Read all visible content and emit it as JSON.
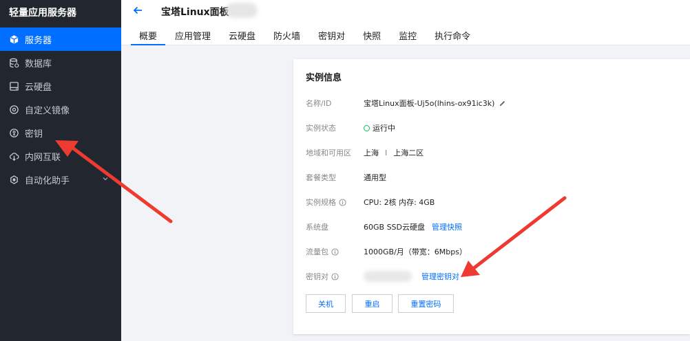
{
  "sidebar": {
    "title": "轻量应用服务器",
    "items": [
      {
        "label": "服务器",
        "icon": "cube-icon",
        "active": true
      },
      {
        "label": "数据库",
        "icon": "database-icon",
        "active": false
      },
      {
        "label": "云硬盘",
        "icon": "disk-icon",
        "active": false
      },
      {
        "label": "自定义镜像",
        "icon": "image-icon",
        "active": false
      },
      {
        "label": "密钥",
        "icon": "key-icon",
        "active": false
      },
      {
        "label": "内网互联",
        "icon": "network-icon",
        "active": false
      },
      {
        "label": "自动化助手",
        "icon": "robot-icon",
        "active": false
      }
    ]
  },
  "header": {
    "title": "宝塔Linux面板",
    "tabs": [
      "概要",
      "应用管理",
      "云硬盘",
      "防火墙",
      "密钥对",
      "快照",
      "监控",
      "执行命令"
    ],
    "active_tab": "概要"
  },
  "card": {
    "title": "实例信息",
    "rows": {
      "name": {
        "label": "名称/ID",
        "value": "宝塔Linux面板-Uj5o(lhins-ox91ic3k)"
      },
      "status": {
        "label": "实例状态",
        "value": "运行中"
      },
      "region": {
        "label": "地域和可用区",
        "region": "上海",
        "separator": "I",
        "zone": "上海二区"
      },
      "plan": {
        "label": "套餐类型",
        "value": "通用型"
      },
      "spec": {
        "label": "实例规格",
        "value": "CPU: 2核 内存: 4GB"
      },
      "disk": {
        "label": "系统盘",
        "value": "60GB SSD云硬盘",
        "link": "管理快照"
      },
      "traffic": {
        "label": "流量包",
        "value": "1000GB/月（带宽：6Mbps）"
      },
      "keypair": {
        "label": "密钥对",
        "link": "管理密钥对"
      }
    },
    "buttons": {
      "shutdown": "关机",
      "restart": "重启",
      "reset_password": "重置密码"
    }
  },
  "colors": {
    "accent": "#006eff",
    "sidebar_bg": "#22272f",
    "running": "#0abf5b",
    "annotation_arrow": "#ee3b32"
  }
}
